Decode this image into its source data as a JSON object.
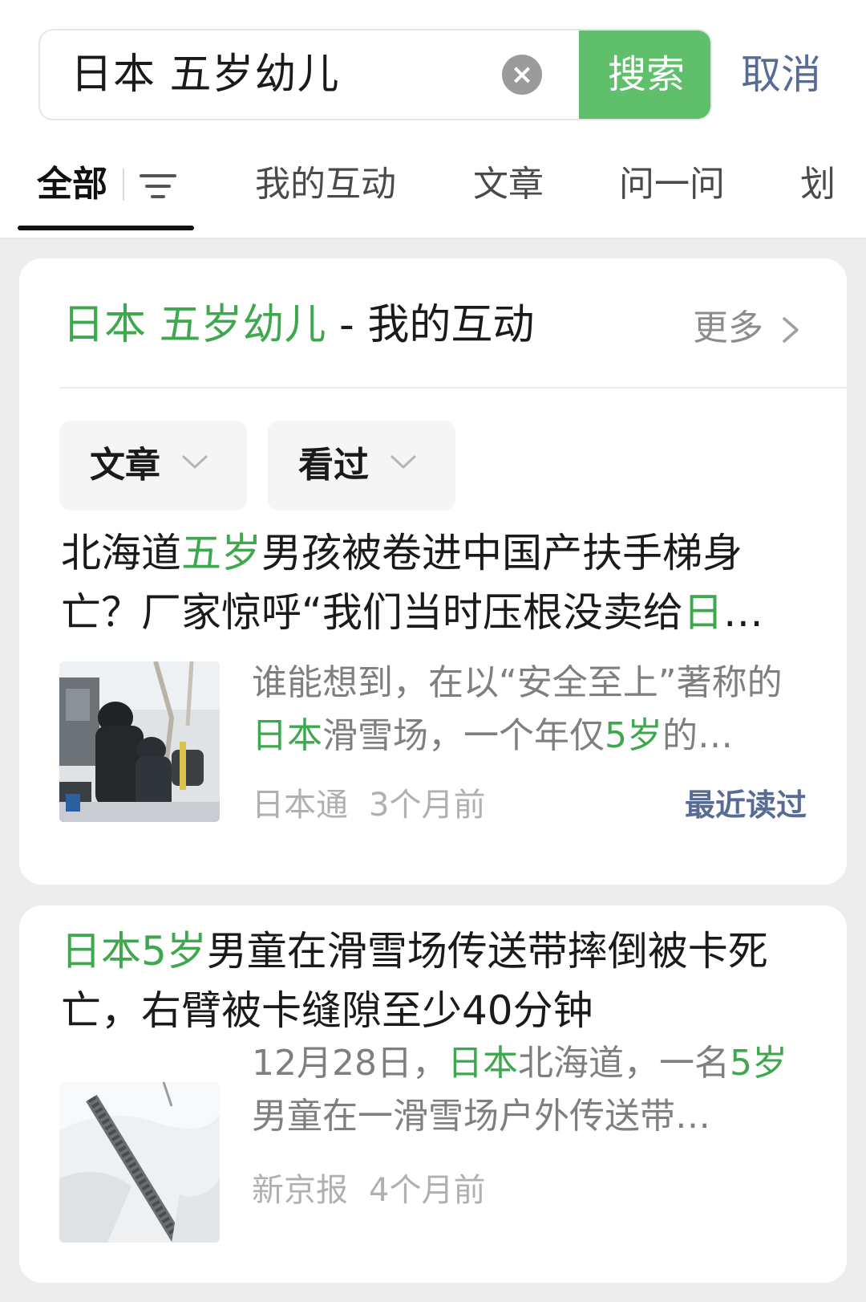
{
  "search": {
    "query": "日本 五岁幼儿",
    "clear_icon": "×",
    "search_label": "搜索",
    "cancel_label": "取消"
  },
  "tabs": [
    {
      "label": "全部",
      "active": true
    },
    {
      "label": "我的互动"
    },
    {
      "label": "文章"
    },
    {
      "label": "问一问"
    },
    {
      "label": "划"
    }
  ],
  "section": {
    "query_highlight": "日本 五岁幼儿",
    "separator": " - ",
    "title": "我的互动",
    "more_label": "更多"
  },
  "filters": [
    {
      "label": "文章"
    },
    {
      "label": "看过"
    }
  ],
  "results": [
    {
      "title_parts": [
        {
          "text": "北海道",
          "hl": false
        },
        {
          "text": "五岁",
          "hl": true
        },
        {
          "text": "男孩被卷进中国产扶手梯身亡？厂家惊呼“我们当时压根没卖给",
          "hl": false
        },
        {
          "text": "日",
          "hl": true
        },
        {
          "text": "…",
          "hl": false
        }
      ],
      "snippet_parts": [
        {
          "text": "谁能想到，在以“安全至上”著称的",
          "hl": false
        },
        {
          "text": "日本",
          "hl": true
        },
        {
          "text": "滑雪场，一个年仅",
          "hl": false
        },
        {
          "text": "5岁",
          "hl": true
        },
        {
          "text": "的…",
          "hl": false
        }
      ],
      "source": "日本通",
      "time": "3个月前",
      "badge": "最近读过"
    },
    {
      "title_parts": [
        {
          "text": "日本5岁",
          "hl": true
        },
        {
          "text": "男童在滑雪场传送带摔倒被卡死亡，右臂被卡缝隙至少40分钟",
          "hl": false
        }
      ],
      "snippet_parts": [
        {
          "text": "12月28日，",
          "hl": false
        },
        {
          "text": "日本",
          "hl": true
        },
        {
          "text": "北海道，一名",
          "hl": false
        },
        {
          "text": "5岁",
          "hl": true
        },
        {
          "text": "男童在一滑雪场户外传送带…",
          "hl": false
        }
      ],
      "source": "新京报",
      "time": "4个月前"
    }
  ],
  "colors": {
    "accent_green": "#3ea84e",
    "search_button": "#5fbf6a",
    "link_blue": "#576b95"
  }
}
